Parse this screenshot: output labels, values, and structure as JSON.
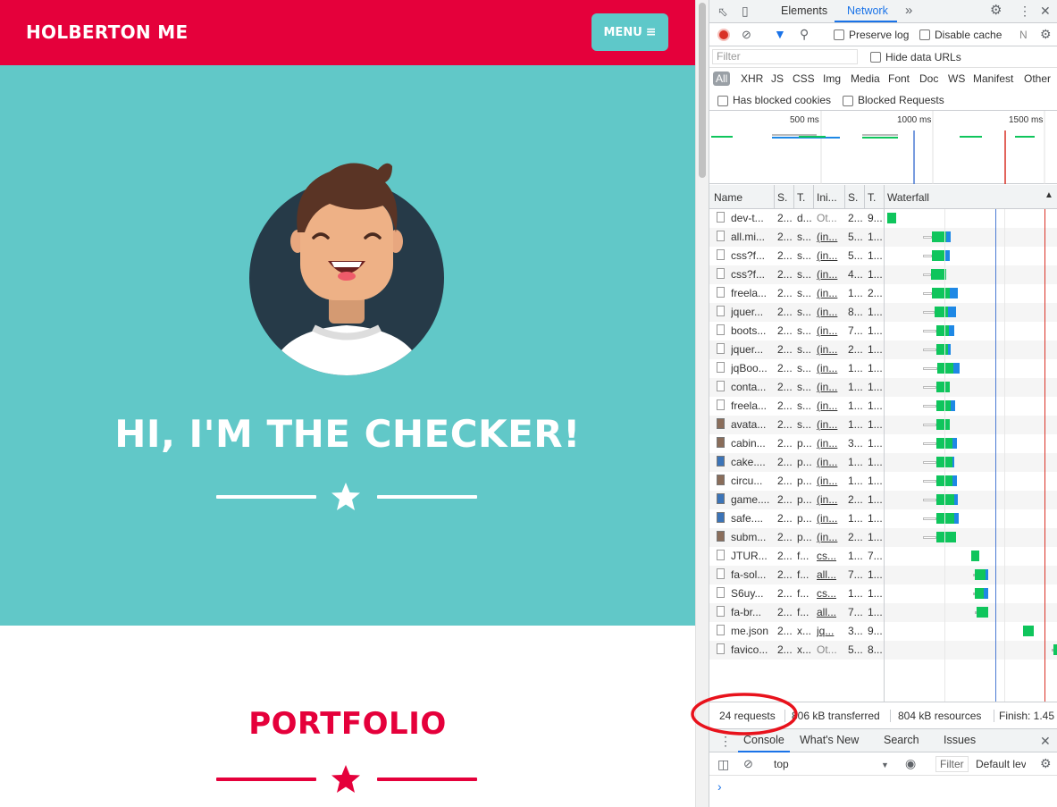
{
  "site": {
    "brand": "HOLBERTON ME",
    "menu_label": "MENU",
    "menu_icon": "hamburger-icon",
    "hero_title": "HI, I'M THE CHECKER!",
    "divider_icon": "star-icon",
    "portfolio_title": "PORTFOLIO",
    "colors": {
      "primary": "#e5003b",
      "teal": "#61c8c8",
      "button": "#5ec8c9"
    }
  },
  "devtools": {
    "tabs": [
      "Elements",
      "Network"
    ],
    "active_tab": "Network",
    "toolbar": {
      "preserve_log": "Preserve log",
      "disable_cache": "Disable cache",
      "overflow": "N"
    },
    "filter": {
      "placeholder": "Filter",
      "hide_data_urls": "Hide data URLs"
    },
    "types": [
      "All",
      "XHR",
      "JS",
      "CSS",
      "Img",
      "Media",
      "Font",
      "Doc",
      "WS",
      "Manifest",
      "Other"
    ],
    "cookies": {
      "has_blocked": "Has blocked cookies",
      "blocked_requests": "Blocked Requests"
    },
    "overview_ticks": [
      "500 ms",
      "1000 ms",
      "1500 ms"
    ],
    "columns": [
      "Name",
      "S.",
      "T.",
      "Ini...",
      "S.",
      "T.",
      "Waterfall"
    ],
    "requests": [
      {
        "name": "dev-t...",
        "status": "2...",
        "type": "d...",
        "initiator": "Ot...",
        "size": "2...",
        "time": "9...",
        "icon": "doc",
        "wf": [
          2,
          0,
          10,
          0
        ]
      },
      {
        "name": "all.mi...",
        "status": "2...",
        "type": "s...",
        "initiator": "(in...",
        "size": "5...",
        "time": "1...",
        "icon": "doc",
        "wf": [
          42,
          10,
          16,
          5
        ]
      },
      {
        "name": "css?f...",
        "status": "2...",
        "type": "s...",
        "initiator": "(in...",
        "size": "5...",
        "time": "1...",
        "icon": "doc",
        "wf": [
          42,
          10,
          15,
          5
        ]
      },
      {
        "name": "css?f...",
        "status": "2...",
        "type": "s...",
        "initiator": "(in...",
        "size": "4...",
        "time": "1...",
        "icon": "doc",
        "wf": [
          42,
          9,
          17,
          0
        ]
      },
      {
        "name": "freela...",
        "status": "2...",
        "type": "s...",
        "initiator": "(in...",
        "size": "1...",
        "time": "2...",
        "icon": "doc",
        "wf": [
          42,
          10,
          20,
          9
        ]
      },
      {
        "name": "jquer...",
        "status": "2...",
        "type": "s...",
        "initiator": "(in...",
        "size": "8...",
        "time": "1...",
        "icon": "doc",
        "wf": [
          42,
          13,
          15,
          9
        ]
      },
      {
        "name": "boots...",
        "status": "2...",
        "type": "s...",
        "initiator": "(in...",
        "size": "7...",
        "time": "1...",
        "icon": "doc",
        "wf": [
          42,
          15,
          14,
          6
        ]
      },
      {
        "name": "jquer...",
        "status": "2...",
        "type": "s...",
        "initiator": "(in...",
        "size": "2...",
        "time": "1...",
        "icon": "doc",
        "wf": [
          42,
          15,
          13,
          3
        ]
      },
      {
        "name": "jqBoo...",
        "status": "2...",
        "type": "s...",
        "initiator": "(in...",
        "size": "1...",
        "time": "1...",
        "icon": "doc",
        "wf": [
          42,
          16,
          18,
          7
        ]
      },
      {
        "name": "conta...",
        "status": "2...",
        "type": "s...",
        "initiator": "(in...",
        "size": "1...",
        "time": "1...",
        "icon": "doc",
        "wf": [
          42,
          15,
          15,
          0
        ]
      },
      {
        "name": "freela...",
        "status": "2...",
        "type": "s...",
        "initiator": "(in...",
        "size": "1...",
        "time": "1...",
        "icon": "doc",
        "wf": [
          42,
          15,
          16,
          5
        ]
      },
      {
        "name": "avata...",
        "status": "2...",
        "type": "s...",
        "initiator": "(in...",
        "size": "1...",
        "time": "1...",
        "icon": "img",
        "wf": [
          42,
          15,
          15,
          0
        ]
      },
      {
        "name": "cabin...",
        "status": "2...",
        "type": "p...",
        "initiator": "(in...",
        "size": "3...",
        "time": "1...",
        "icon": "img",
        "wf": [
          42,
          15,
          18,
          5
        ]
      },
      {
        "name": "cake....",
        "status": "2...",
        "type": "p...",
        "initiator": "(in...",
        "size": "1...",
        "time": "1...",
        "icon": "img2",
        "wf": [
          42,
          15,
          18,
          2
        ]
      },
      {
        "name": "circu...",
        "status": "2...",
        "type": "p...",
        "initiator": "(in...",
        "size": "1...",
        "time": "1...",
        "icon": "img",
        "wf": [
          42,
          15,
          18,
          5
        ]
      },
      {
        "name": "game....",
        "status": "2...",
        "type": "p...",
        "initiator": "(in...",
        "size": "2...",
        "time": "1...",
        "icon": "img2",
        "wf": [
          42,
          15,
          20,
          4
        ]
      },
      {
        "name": "safe....",
        "status": "2...",
        "type": "p...",
        "initiator": "(in...",
        "size": "1...",
        "time": "1...",
        "icon": "img2",
        "wf": [
          42,
          15,
          20,
          5
        ]
      },
      {
        "name": "subm...",
        "status": "2...",
        "type": "p...",
        "initiator": "(in...",
        "size": "2...",
        "time": "1...",
        "icon": "img",
        "wf": [
          42,
          15,
          22,
          0
        ]
      },
      {
        "name": "JTUR...",
        "status": "2...",
        "type": "f...",
        "initiator": "cs...",
        "size": "1...",
        "time": "7...",
        "icon": "doc",
        "wf": [
          96,
          0,
          9,
          0
        ]
      },
      {
        "name": "fa-sol...",
        "status": "2...",
        "type": "f...",
        "initiator": "all...",
        "size": "7...",
        "time": "1...",
        "icon": "doc",
        "wf": [
          98,
          2,
          12,
          3
        ]
      },
      {
        "name": "S6uy...",
        "status": "2...",
        "type": "f...",
        "initiator": "cs...",
        "size": "1...",
        "time": "1...",
        "icon": "doc",
        "wf": [
          98,
          2,
          10,
          5
        ]
      },
      {
        "name": "fa-br...",
        "status": "2...",
        "type": "f...",
        "initiator": "all...",
        "size": "7...",
        "time": "1...",
        "icon": "doc",
        "wf": [
          100,
          2,
          13,
          0
        ]
      },
      {
        "name": "me.json",
        "status": "2...",
        "type": "x...",
        "initiator": "jq...",
        "size": "3...",
        "time": "9...",
        "icon": "doc",
        "wf": [
          154,
          0,
          12,
          0
        ]
      },
      {
        "name": "favico...",
        "status": "2...",
        "type": "x...",
        "initiator": "Ot...",
        "size": "5...",
        "time": "8...",
        "icon": "doc",
        "wf": [
          186,
          2,
          8,
          0
        ]
      }
    ],
    "summary": {
      "requests": "24 requests",
      "transferred": "806 kB transferred",
      "resources": "804 kB resources",
      "finish": "Finish: 1.45"
    },
    "drawer_tabs": [
      "Console",
      "What's New",
      "Search",
      "Issues"
    ],
    "console": {
      "context": "top",
      "filter_placeholder": "Filter",
      "levels": "Default lev"
    },
    "colors": {
      "accent": "#1a73e8",
      "bar_green": "#0fc55c",
      "bar_blue": "#1e88e5",
      "dom_line": "#4b7bd4",
      "load_line": "#d93025"
    }
  }
}
